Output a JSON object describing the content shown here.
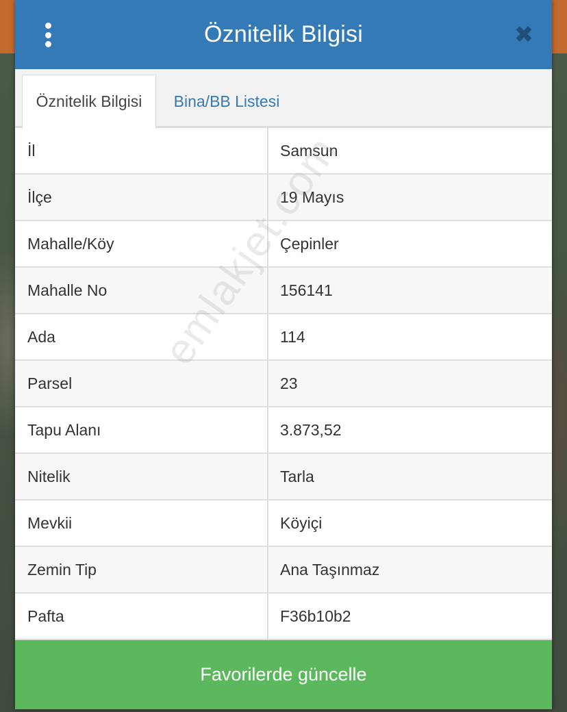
{
  "header": {
    "title": "Öznitelik Bilgisi",
    "menu_icon": "kebab-menu-icon",
    "close_icon": "close-icon",
    "close_glyph": "✖"
  },
  "tabs": [
    {
      "label": "Öznitelik Bilgisi",
      "active": true
    },
    {
      "label": "Bina/BB Listesi",
      "active": false
    }
  ],
  "attributes": [
    {
      "key": "İl",
      "value": "Samsun"
    },
    {
      "key": "İlçe",
      "value": "19 Mayıs"
    },
    {
      "key": "Mahalle/Köy",
      "value": "Çepinler"
    },
    {
      "key": "Mahalle No",
      "value": "156141"
    },
    {
      "key": "Ada",
      "value": "114"
    },
    {
      "key": "Parsel",
      "value": "23"
    },
    {
      "key": "Tapu Alanı",
      "value": "3.873,52"
    },
    {
      "key": "Nitelik",
      "value": "Tarla"
    },
    {
      "key": "Mevkii",
      "value": "Köyiçi"
    },
    {
      "key": "Zemin Tip",
      "value": "Ana Taşınmaz"
    },
    {
      "key": "Pafta",
      "value": "F36b10b2"
    }
  ],
  "footer": {
    "button_label": "Favorilerde güncelle"
  },
  "watermark": "emlakjet.com",
  "colors": {
    "header": "#337ab7",
    "button": "#5cb85c",
    "tab_link": "#337ab7"
  }
}
